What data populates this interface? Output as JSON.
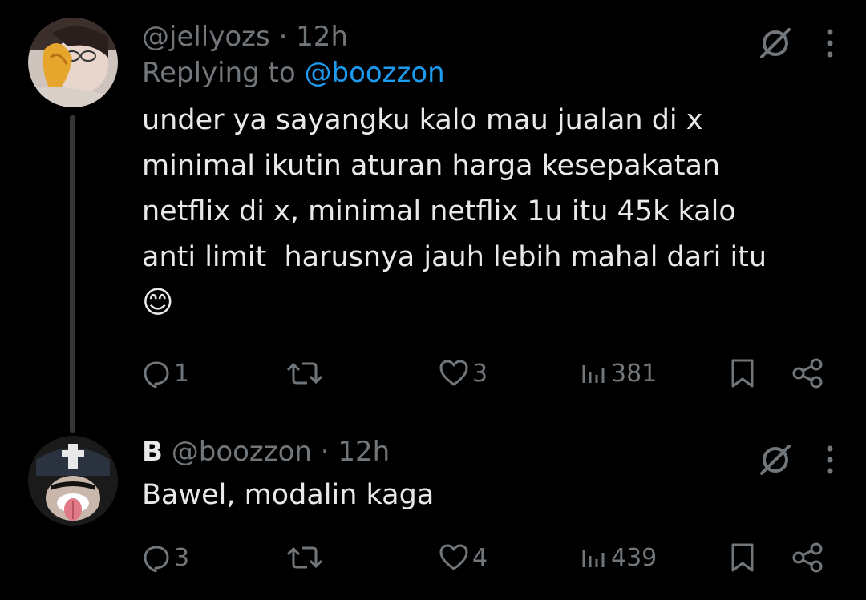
{
  "tweets": [
    {
      "handle": "@jellyozs",
      "time": "· 12h",
      "replying_prefix": "Replying to",
      "replying_to": "@boozzon",
      "text": "under ya sayangku kalo mau jualan di x\nminimal ikutin aturan harga kesepakatan\nnetflix di x, minimal netflix 1u itu 45k kalo\nanti limit  harusnya jauh lebih mahal dari itu",
      "emoji": "😊",
      "replies": "1",
      "likes": "3",
      "views": "381"
    },
    {
      "name": "B",
      "handle": "@boozzon",
      "time": "· 12h",
      "text": "Bawel, modalin kaga",
      "replies": "3",
      "likes": "4",
      "views": "439"
    }
  ],
  "colors": {
    "background": "#000000",
    "text": "#e7e9ea",
    "muted": "#71767b",
    "link": "#1d9bf0"
  },
  "icons": [
    "grok-icon",
    "more-icon",
    "reply-icon",
    "retweet-icon",
    "like-icon",
    "views-icon",
    "bookmark-icon",
    "share-icon"
  ]
}
